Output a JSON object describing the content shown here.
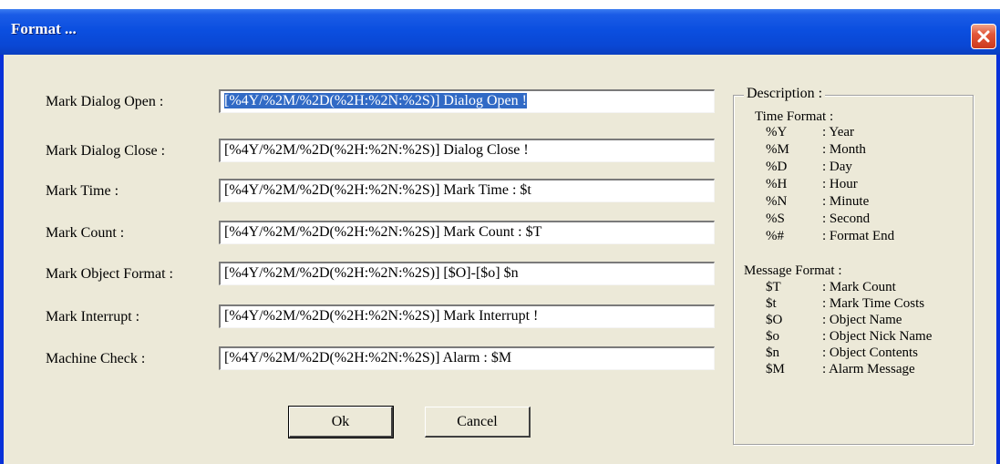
{
  "window": {
    "title": "Format ..."
  },
  "rows": [
    {
      "label": "Mark Dialog Open :",
      "value": "[%4Y/%2M/%2D(%2H:%2N:%2S)] Dialog Open !"
    },
    {
      "label": "Mark Dialog Close :",
      "value": "[%4Y/%2M/%2D(%2H:%2N:%2S)] Dialog Close !"
    },
    {
      "label": "Mark Time :",
      "value": "[%4Y/%2M/%2D(%2H:%2N:%2S)] Mark Time : $t"
    },
    {
      "label": "Mark Count :",
      "value": "[%4Y/%2M/%2D(%2H:%2N:%2S)] Mark Count : $T"
    },
    {
      "label": "Mark Object Format :",
      "value": "[%4Y/%2M/%2D(%2H:%2N:%2S)] [$O]-[$o] $n"
    },
    {
      "label": "Mark Interrupt :",
      "value": "[%4Y/%2M/%2D(%2H:%2N:%2S)] Mark Interrupt !"
    },
    {
      "label": "Machine Check :",
      "value": "[%4Y/%2M/%2D(%2H:%2N:%2S)] Alarm : $M"
    }
  ],
  "buttons": {
    "ok": "Ok",
    "cancel": "Cancel"
  },
  "description": {
    "title": "Description :",
    "time_title": "Time Format :",
    "time_items": [
      {
        "key": "%Y",
        "desc": ": Year"
      },
      {
        "key": "%M",
        "desc": ": Month"
      },
      {
        "key": "%D",
        "desc": ": Day"
      },
      {
        "key": "%H",
        "desc": ": Hour"
      },
      {
        "key": "%N",
        "desc": ": Minute"
      },
      {
        "key": "%S",
        "desc": ": Second"
      },
      {
        "key": "%#",
        "desc": ": Format End"
      }
    ],
    "message_title": "Message Format :",
    "message_items": [
      {
        "key": "$T",
        "desc": ": Mark Count"
      },
      {
        "key": "$t",
        "desc": ": Mark Time Costs"
      },
      {
        "key": "$O",
        "desc": ": Object Name"
      },
      {
        "key": "$o",
        "desc": ": Object Nick Name"
      },
      {
        "key": "$n",
        "desc": ": Object Contents"
      },
      {
        "key": "$M",
        "desc": ": Alarm Message"
      }
    ]
  },
  "colors": {
    "title_bar": "#0a47d4",
    "face": "#ece9d8",
    "selection": "#316ac5",
    "close": "#e2573a"
  },
  "icons": {
    "close": "close-icon"
  }
}
